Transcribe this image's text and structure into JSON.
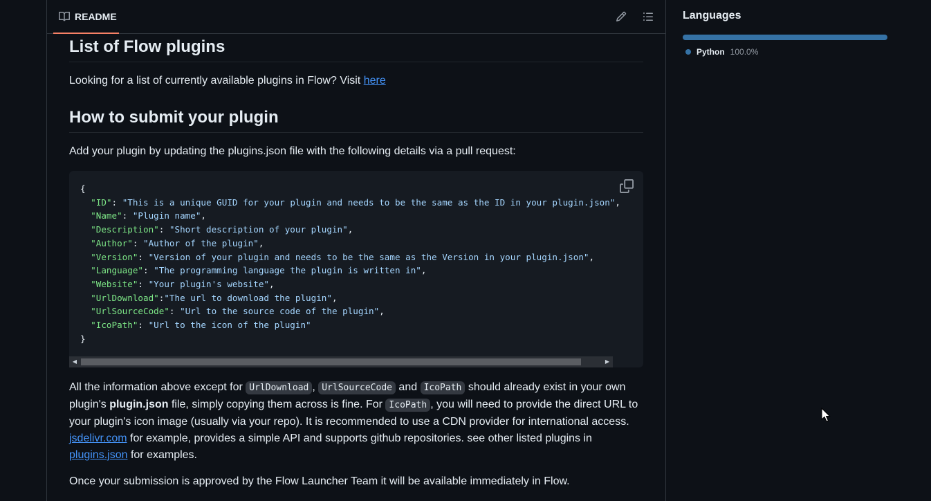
{
  "readme": {
    "tab_label": "README",
    "icons": {
      "tab": "book-icon",
      "edit": "pencil-icon",
      "toc": "list-icon",
      "copy": "copy-icon"
    }
  },
  "content": {
    "heading1": "List of Flow plugins",
    "p1_text": "Looking for a list of currently available plugins in Flow? Visit ",
    "p1_link": "here",
    "heading2": "How to submit your plugin",
    "p2_text": "Add your plugin by updating the plugins.json file with the following details via a pull request:",
    "code": {
      "open": "{",
      "close": "}",
      "lines": [
        {
          "key": "\"ID\"",
          "sep": ": ",
          "value": "\"This is a unique GUID for your plugin and needs to be the same as the ID in your plugin.json\"",
          "tail": ","
        },
        {
          "key": "\"Name\"",
          "sep": ": ",
          "value": "\"Plugin name\"",
          "tail": ","
        },
        {
          "key": "\"Description\"",
          "sep": ": ",
          "value": "\"Short description of your plugin\"",
          "tail": ","
        },
        {
          "key": "\"Author\"",
          "sep": ": ",
          "value": "\"Author of the plugin\"",
          "tail": ","
        },
        {
          "key": "\"Version\"",
          "sep": ": ",
          "value": "\"Version of your plugin and needs to be the same as the Version in your plugin.json\"",
          "tail": ","
        },
        {
          "key": "\"Language\"",
          "sep": ": ",
          "value": "\"The programming language the plugin is written in\"",
          "tail": ","
        },
        {
          "key": "\"Website\"",
          "sep": ": ",
          "value": "\"Your plugin's website\"",
          "tail": ","
        },
        {
          "key": "\"UrlDownload\"",
          "sep": ":",
          "value": "\"The url to download the plugin\"",
          "tail": ","
        },
        {
          "key": "\"UrlSourceCode\"",
          "sep": ": ",
          "value": "\"Url to the source code of the plugin\"",
          "tail": ","
        },
        {
          "key": "\"IcoPath\"",
          "sep": ": ",
          "value": "\"Url to the icon of the plugin\"",
          "tail": ""
        }
      ]
    },
    "p3": {
      "t1": "All the information above except for ",
      "c1": "UrlDownload",
      "t2": ", ",
      "c2": "UrlSourceCode",
      "t3": " and ",
      "c3": "IcoPath",
      "t4": " should already exist in your own plugin's ",
      "bold": "plugin.json",
      "t5": " file, simply copying them across is fine. For ",
      "c4": "IcoPath",
      "t6": ", you will need to provide the direct URL to your plugin's icon image (usually via your repo). It is recommended to use a CDN provider for international access. ",
      "link1": "jsdelivr.com",
      "t7": " for example, provides a simple API and supports github repositories. see other listed plugins in ",
      "link2": "plugins.json",
      "t8": " for examples."
    },
    "p4_text": "Once your submission is approved by the Flow Launcher Team it will be available immediately in Flow."
  },
  "sidebar": {
    "languages_title": "Languages",
    "languages": [
      {
        "name": "Python",
        "percent": "100.0%",
        "share": 1.0,
        "color": "#3572a5"
      }
    ]
  }
}
